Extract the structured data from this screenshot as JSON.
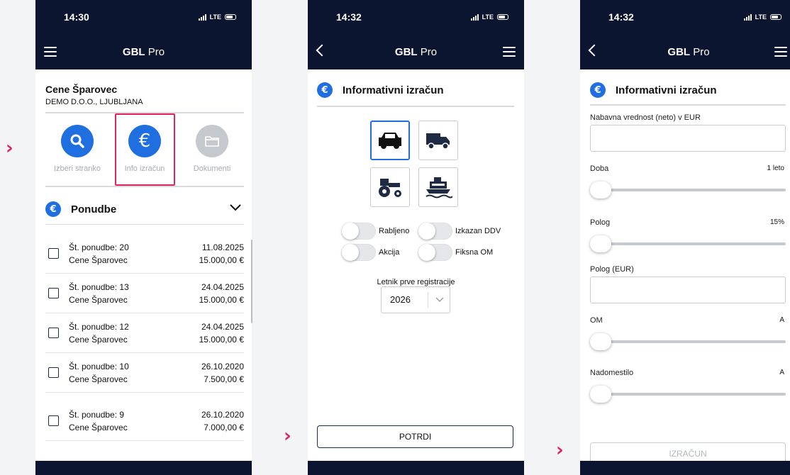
{
  "colors": {
    "navy": "#0b1530",
    "accent_blue": "#1f6fe0",
    "highlight_red": "#e0245e",
    "disabled_gray": "#a6abb3"
  },
  "arrows": [
    "›",
    "›",
    "›"
  ],
  "screens": [
    {
      "time": "14:30",
      "network": "LTE",
      "title_bold": "GBL",
      "title_regular": " Pro",
      "customer": {
        "name": "Cene Šparovec",
        "company": "DEMO D.O.O., LJUBLJANA"
      },
      "actions": [
        {
          "label": "Izberi stranko",
          "icon": "search-icon",
          "color": "#1f6fe0"
        },
        {
          "label": "Info izračun",
          "icon": "euro-icon",
          "color": "#1f6fe0"
        },
        {
          "label": "Dokumenti",
          "icon": "folder-icon",
          "color": "#c5c8cd"
        }
      ],
      "offers_title": "Ponudbe",
      "offers": [
        {
          "number": "Št. ponudbe: 20",
          "customer": "Cene Šparovec",
          "date": "11.08.2025",
          "amount": "15.000,00 €"
        },
        {
          "number": "Št. ponudbe: 13",
          "customer": "Cene Šparovec",
          "date": "24.04.2025",
          "amount": "15.000,00 €"
        },
        {
          "number": "Št. ponudbe: 12",
          "customer": "Cene Šparovec",
          "date": "24.04.2025",
          "amount": "15.000,00 €"
        },
        {
          "number": "Št. ponudbe: 10",
          "customer": "Cene Šparovec",
          "date": "26.10.2020",
          "amount": "7.500,00 €"
        },
        {
          "number": "Št. ponudbe: 9",
          "customer": "Cene Šparovec",
          "date": "26.10.2020",
          "amount": "7.000,00 €"
        }
      ]
    },
    {
      "time": "14:32",
      "network": "LTE",
      "title_bold": "GBL",
      "title_regular": " Pro",
      "section_title": "Informativni izračun",
      "vehicles": [
        "car-icon",
        "truck-icon",
        "tractor-icon",
        "boat-icon"
      ],
      "selected_vehicle": "car-icon",
      "toggles": [
        {
          "label": "Rabljeno",
          "on": false
        },
        {
          "label": "Izkazan DDV",
          "on": false
        },
        {
          "label": "Akcija",
          "on": false
        },
        {
          "label": "Fiksna OM",
          "on": false
        }
      ],
      "year_label": "Letnik prve registracije",
      "year_value": "2026",
      "confirm_label": "POTRDI"
    },
    {
      "time": "14:32",
      "network": "LTE",
      "title_bold": "GBL",
      "title_regular": " Pro",
      "section_title": "Informativni izračun",
      "purchase_label": "Nabavna vrednost (neto) v EUR",
      "sliders": [
        {
          "label": "Doba",
          "value": "1 leto",
          "level": 0
        },
        {
          "label": "Polog",
          "value": "15%",
          "level": 0
        },
        {
          "label": "OM",
          "value": "A",
          "level": 0
        },
        {
          "label": "Nadomestilo",
          "value": "A",
          "level": 0
        }
      ],
      "deposit_label": "Polog (EUR)",
      "calculate_label": "IZRAČUN"
    }
  ]
}
